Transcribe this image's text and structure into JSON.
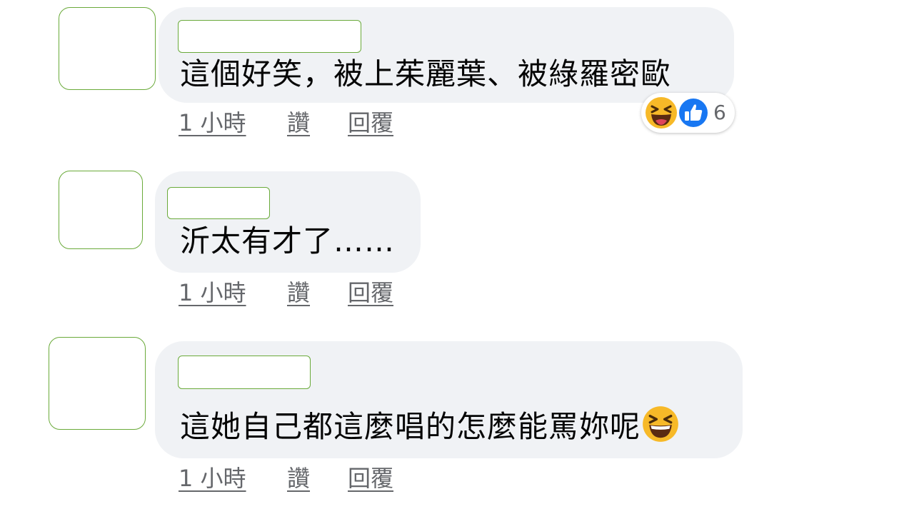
{
  "comments": [
    {
      "text": "這個好笑，被上茱麗葉、被綠羅密歐",
      "actions": {
        "time": "1 小時",
        "like": "讚",
        "reply": "回覆"
      },
      "reactions": {
        "icons": [
          "laughing-emoji",
          "thumbs-up-emoji"
        ],
        "count": "6"
      }
    },
    {
      "text": "沂太有才了……",
      "actions": {
        "time": "1 小時",
        "like": "讚",
        "reply": "回覆"
      }
    },
    {
      "text": "這她自己都這麼唱的怎麼能罵妳呢",
      "inline_emoji": "grinning-squinting-emoji",
      "actions": {
        "time": "1 小時",
        "like": "讚",
        "reply": "回覆"
      }
    }
  ],
  "colors": {
    "bubble": "#f0f2f5",
    "text": "#050505",
    "secondary_text": "#65676b",
    "like_blue": "#1877f2",
    "emoji_yellow": "#f7b928",
    "redaction_border": "#6aaa3a"
  }
}
